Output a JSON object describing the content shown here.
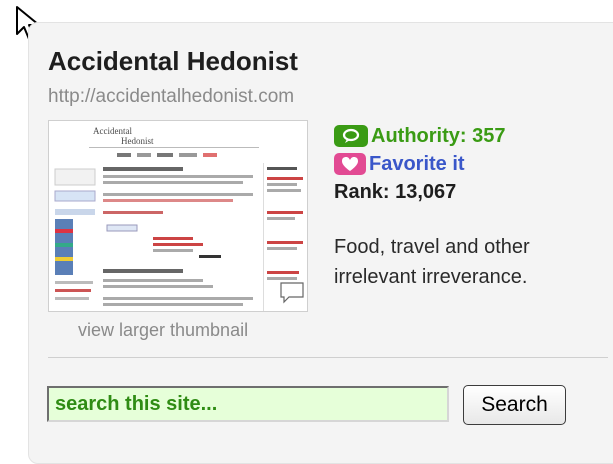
{
  "site": {
    "title": "Accidental Hedonist",
    "url": "http://accidentalhedonist.com",
    "thumbnail_link": "view larger thumbnail",
    "description": "Food, travel and other irrelevant irreverance."
  },
  "stats": {
    "authority_label": "Authority: 357",
    "favorite_label": "Favorite it",
    "rank_label": "Rank: 13,067"
  },
  "search": {
    "placeholder": "search this site...",
    "button_label": "Search"
  },
  "thumbnail": {
    "logo_text": "Accidental Hedonist"
  },
  "colors": {
    "authority_green": "#3a9b14",
    "favorite_blue": "#3a57c9",
    "favorite_pink": "#e24a93",
    "search_bg": "#e6ffd9"
  },
  "icons": {
    "cursor": "arrow-cursor-icon",
    "authority": "speech-bubble-icon",
    "favorite": "heart-icon"
  }
}
